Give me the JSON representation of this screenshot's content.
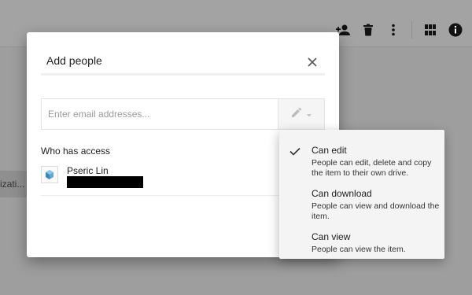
{
  "background": {
    "toolbar_icons": [
      "add-person-icon",
      "trash-icon",
      "more-vert-icon",
      "grid-view-icon",
      "info-icon"
    ],
    "side_chip_text": "izati..."
  },
  "dialog": {
    "title": "Add people",
    "close_icon": "close-icon",
    "email_placeholder": "Enter email addresses...",
    "email_value": "",
    "permission_icon": "pencil-icon",
    "who_has_access_label": "Who has access",
    "users": [
      {
        "name": "Pseric Lin",
        "email_redacted": true,
        "avatar_icon": "cube-avatar-icon"
      }
    ]
  },
  "permission_menu": {
    "selected": "Can edit",
    "items": [
      {
        "title": "Can edit",
        "description": "People can edit, delete and copy the item to their own drive.",
        "checked": true
      },
      {
        "title": "Can download",
        "description": "People can view and download the item.",
        "checked": false
      },
      {
        "title": "Can view",
        "description": "People can view the item.",
        "checked": false
      }
    ]
  },
  "colors": {
    "overlay": "#9e9e9e",
    "dialog_bg": "#ffffff",
    "menu_bg": "#f4f4f4",
    "icon_dark": "#212121"
  }
}
